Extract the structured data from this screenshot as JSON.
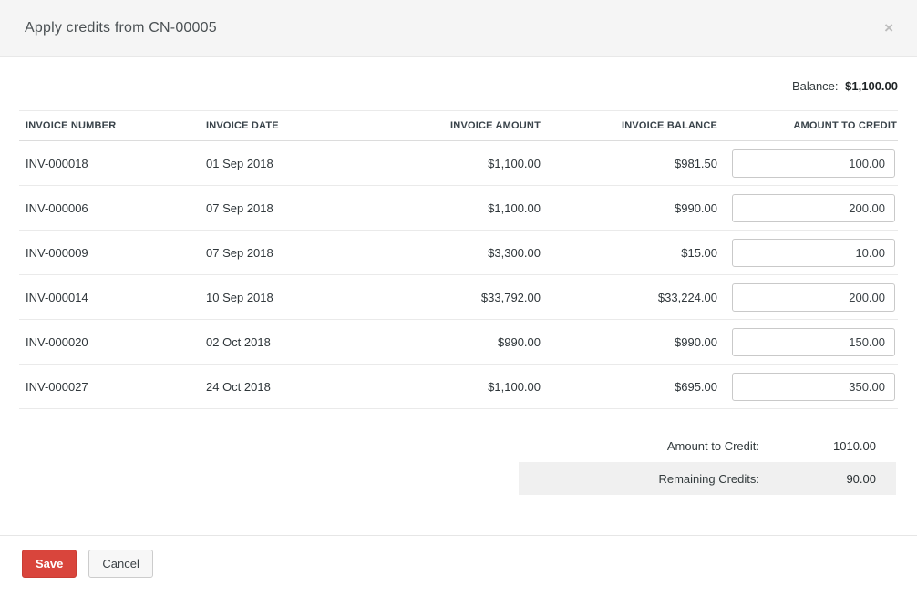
{
  "modal": {
    "title": "Apply credits from CN-00005",
    "close_glyph": "×"
  },
  "balance": {
    "label": "Balance:",
    "value": "$1,100.00"
  },
  "table": {
    "columns": [
      "INVOICE NUMBER",
      "INVOICE DATE",
      "INVOICE AMOUNT",
      "INVOICE BALANCE",
      "AMOUNT TO CREDIT"
    ],
    "rows": [
      {
        "invoice_number": "INV-000018",
        "invoice_date": "01 Sep 2018",
        "invoice_amount": "$1,100.00",
        "invoice_balance": "$981.50",
        "amount_to_credit": "100.00"
      },
      {
        "invoice_number": "INV-000006",
        "invoice_date": "07 Sep 2018",
        "invoice_amount": "$1,100.00",
        "invoice_balance": "$990.00",
        "amount_to_credit": "200.00"
      },
      {
        "invoice_number": "INV-000009",
        "invoice_date": "07 Sep 2018",
        "invoice_amount": "$3,300.00",
        "invoice_balance": "$15.00",
        "amount_to_credit": "10.00"
      },
      {
        "invoice_number": "INV-000014",
        "invoice_date": "10 Sep 2018",
        "invoice_amount": "$33,792.00",
        "invoice_balance": "$33,224.00",
        "amount_to_credit": "200.00"
      },
      {
        "invoice_number": "INV-000020",
        "invoice_date": "02 Oct 2018",
        "invoice_amount": "$990.00",
        "invoice_balance": "$990.00",
        "amount_to_credit": "150.00"
      },
      {
        "invoice_number": "INV-000027",
        "invoice_date": "24 Oct 2018",
        "invoice_amount": "$1,100.00",
        "invoice_balance": "$695.00",
        "amount_to_credit": "350.00"
      }
    ]
  },
  "summary": {
    "amount_to_credit_label": "Amount to Credit:",
    "amount_to_credit_value": "1010.00",
    "remaining_credits_label": "Remaining Credits:",
    "remaining_credits_value": "90.00"
  },
  "footer": {
    "save_label": "Save",
    "cancel_label": "Cancel"
  },
  "colors": {
    "accent_red": "#d9453c",
    "header_bg": "#f5f5f5",
    "summary_highlight_bg": "#f0f0f0",
    "border": "#eaeaea"
  }
}
